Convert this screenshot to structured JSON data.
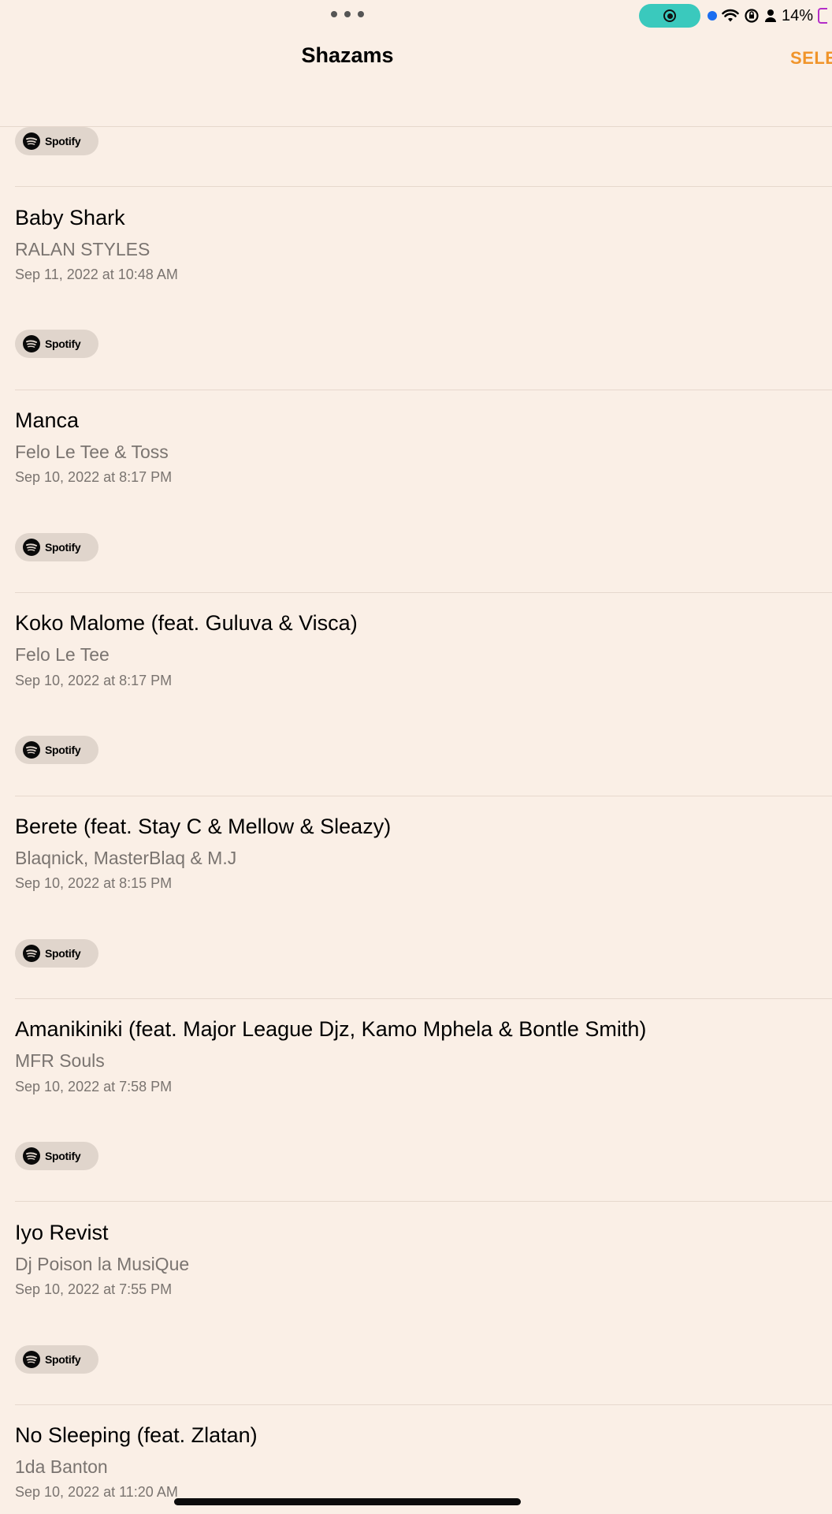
{
  "status_bar": {
    "battery_percent": "14%",
    "accent_color": "#3ac9bd",
    "battery_color": "#b42ec8"
  },
  "header": {
    "title": "Shazams",
    "select_label": "SELE",
    "accent_color": "#f0942a"
  },
  "service_label": "Spotify",
  "songs": [
    {
      "title": "Baby Shark",
      "artist": "RALAN STYLES",
      "date": "Sep 11, 2022 at 10:48 AM"
    },
    {
      "title": "Manca",
      "artist": "Felo Le Tee & Toss",
      "date": "Sep 10, 2022 at 8:17 PM"
    },
    {
      "title": "Koko Malome (feat. Guluva & Visca)",
      "artist": "Felo Le Tee",
      "date": "Sep 10, 2022 at 8:17 PM"
    },
    {
      "title": "Berete (feat. Stay C & Mellow & Sleazy)",
      "artist": "Blaqnick, MasterBlaq & M.J",
      "date": "Sep 10, 2022 at 8:15 PM"
    },
    {
      "title": "Amanikiniki (feat. Major League Djz, Kamo Mphela & Bontle Smith)",
      "artist": "MFR Souls",
      "date": "Sep 10, 2022 at 7:58 PM"
    },
    {
      "title": "Iyo Revist",
      "artist": "Dj Poison la MusiQue",
      "date": "Sep 10, 2022 at 7:55 PM"
    },
    {
      "title": "No Sleeping (feat. Zlatan)",
      "artist": "1da Banton",
      "date": "Sep 10, 2022 at 11:20 AM"
    }
  ]
}
